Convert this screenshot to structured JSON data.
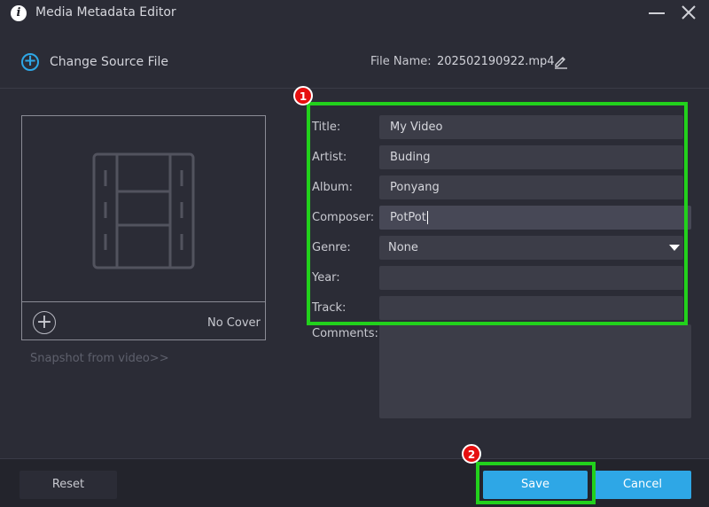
{
  "window": {
    "title": "Media Metadata Editor",
    "app_icon_glyph": "i",
    "minimize_icon": "minimize-icon",
    "close_icon": "close-icon"
  },
  "toolbar": {
    "change_source_label": "Change Source File",
    "file_name_label": "File Name:",
    "file_name_value": "202502190922.mp4",
    "edit_icon": "pencil-icon"
  },
  "cover": {
    "no_cover_label": "No Cover",
    "add_glyph": "+",
    "snapshot_link": "Snapshot from video>>"
  },
  "form": {
    "title_label": "Title:",
    "title_value": "My Video",
    "artist_label": "Artist:",
    "artist_value": "Buding",
    "album_label": "Album:",
    "album_value": "Ponyang",
    "composer_label": "Composer:",
    "composer_value": "PotPot",
    "genre_label": "Genre:",
    "genre_value": "None",
    "year_label": "Year:",
    "year_value": "",
    "track_label": "Track:",
    "track_value": "",
    "comments_label": "Comments:",
    "comments_value": ""
  },
  "annotations": {
    "step1": "1",
    "step2": "2",
    "highlight_color": "#22d11c",
    "badge_color": "#e60f0f"
  },
  "footer": {
    "reset_label": "Reset",
    "save_label": "Save",
    "cancel_label": "Cancel"
  },
  "colors": {
    "accent": "#2ea7e6",
    "background": "#2b2c36",
    "field": "#3c3d48"
  }
}
